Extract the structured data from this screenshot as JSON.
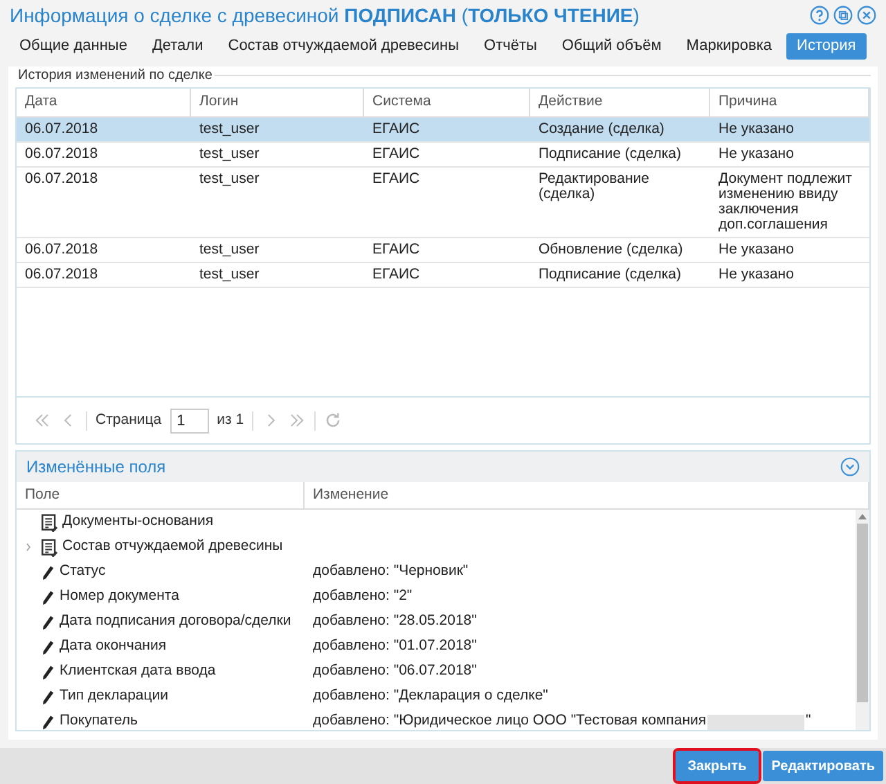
{
  "window": {
    "title": "Информация о сделке с древесиной **ПОДПИСАН** (**ТОЛЬКО ЧТЕНИЕ**)"
  },
  "tabs": [
    {
      "label": "Общие данные",
      "selected": false
    },
    {
      "label": "Детали",
      "selected": false
    },
    {
      "label": "Состав отчуждаемой древесины",
      "selected": false
    },
    {
      "label": "Отчёты",
      "selected": false
    },
    {
      "label": "Общий объём",
      "selected": false
    },
    {
      "label": "Маркировка",
      "selected": false
    },
    {
      "label": "История",
      "selected": true
    }
  ],
  "history": {
    "legend": "История изменений по сделке",
    "columns": [
      "Дата",
      "Логин",
      "Система",
      "Действие",
      "Причина"
    ],
    "rows": [
      {
        "selected": true,
        "cells": [
          "06.07.2018",
          "test_user",
          "ЕГАИС",
          "Создание (сделка)",
          "Не указано"
        ]
      },
      {
        "selected": false,
        "cells": [
          "06.07.2018",
          "test_user",
          "ЕГАИС",
          "Подписание (сделка)",
          "Не указано"
        ]
      },
      {
        "selected": false,
        "cells": [
          "06.07.2018",
          "test_user",
          "ЕГАИС",
          "Редактирование (сделка)",
          "Документ подлежит изменению ввиду заключения доп.соглашения"
        ]
      },
      {
        "selected": false,
        "cells": [
          "06.07.2018",
          "test_user",
          "ЕГАИС",
          "Обновление (сделка)",
          "Не указано"
        ]
      },
      {
        "selected": false,
        "cells": [
          "06.07.2018",
          "test_user",
          "ЕГАИС",
          "Подписание (сделка)",
          "Не указано"
        ]
      }
    ],
    "pager": {
      "page_label": "Страница",
      "page": "1",
      "of": "из 1"
    }
  },
  "changed_fields": {
    "title": "Изменённые поля",
    "expanded": true,
    "columns": [
      "Поле",
      "Изменение"
    ],
    "rows": [
      {
        "kind": "group",
        "expandable": false,
        "field": "Документы-основания"
      },
      {
        "kind": "group",
        "expandable": true,
        "field": "Состав отчуждаемой древесины"
      },
      {
        "kind": "field",
        "field": "Статус",
        "value": "добавлено: \"Черновик\""
      },
      {
        "kind": "field",
        "field": "Номер документа",
        "value": "добавлено: \"2\""
      },
      {
        "kind": "field",
        "field": "Дата подписания договора/сделки",
        "value": "добавлено: \"28.05.2018\""
      },
      {
        "kind": "field",
        "field": "Дата окончания",
        "value": "добавлено: \"01.07.2018\""
      },
      {
        "kind": "field",
        "field": "Клиентская дата ввода",
        "value": "добавлено: \"06.07.2018\""
      },
      {
        "kind": "field",
        "field": "Тип декларации",
        "value": "добавлено: \"Декларация о сделке\""
      },
      {
        "kind": "field",
        "field": "Покупатель",
        "value": "добавлено: \"Юридическое лицо ООО \"Тестовая компания",
        "redacted": true,
        "value_end": "\""
      }
    ]
  },
  "buttons": [
    {
      "label": "Закрыть",
      "highlighted": true
    },
    {
      "label": "Редактировать",
      "highlighted": false
    }
  ]
}
